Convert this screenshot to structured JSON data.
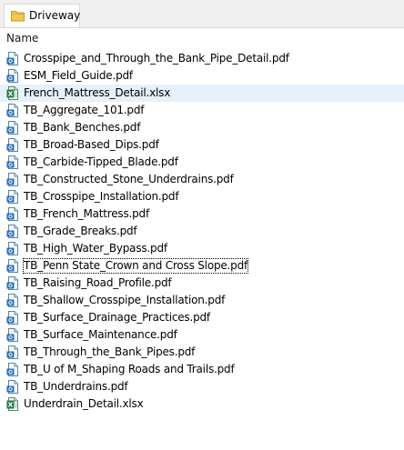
{
  "tab": {
    "label": "Driveway",
    "icon": "folder-icon"
  },
  "header": {
    "name_label": "Name"
  },
  "files": [
    {
      "name": "Crosspipe_and_Through_the_Bank_Pipe_Detail.pdf",
      "type": "pdf",
      "icon": "pdf-file-icon"
    },
    {
      "name": "ESM_Field_Guide.pdf",
      "type": "pdf",
      "icon": "pdf-file-icon"
    },
    {
      "name": "French_Mattress_Detail.xlsx",
      "type": "xlsx",
      "icon": "excel-file-icon",
      "selected": true
    },
    {
      "name": "TB_Aggregate_101.pdf",
      "type": "pdf",
      "icon": "pdf-file-icon"
    },
    {
      "name": "TB_Bank_Benches.pdf",
      "type": "pdf",
      "icon": "pdf-file-icon"
    },
    {
      "name": "TB_Broad-Based_Dips.pdf",
      "type": "pdf",
      "icon": "pdf-file-icon"
    },
    {
      "name": "TB_Carbide-Tipped_Blade.pdf",
      "type": "pdf",
      "icon": "pdf-file-icon"
    },
    {
      "name": "TB_Constructed_Stone_Underdrains.pdf",
      "type": "pdf",
      "icon": "pdf-file-icon"
    },
    {
      "name": "TB_Crosspipe_Installation.pdf",
      "type": "pdf",
      "icon": "pdf-file-icon"
    },
    {
      "name": "TB_French_Mattress.pdf",
      "type": "pdf",
      "icon": "pdf-file-icon"
    },
    {
      "name": "TB_Grade_Breaks.pdf",
      "type": "pdf",
      "icon": "pdf-file-icon"
    },
    {
      "name": "TB_High_Water_Bypass.pdf",
      "type": "pdf",
      "icon": "pdf-file-icon"
    },
    {
      "name": "TB_Penn State_Crown and Cross Slope.pdf",
      "type": "pdf",
      "icon": "pdf-file-icon",
      "focused": true
    },
    {
      "name": "TB_Raising_Road_Profile.pdf",
      "type": "pdf",
      "icon": "pdf-file-icon"
    },
    {
      "name": "TB_Shallow_Crosspipe_Installation.pdf",
      "type": "pdf",
      "icon": "pdf-file-icon"
    },
    {
      "name": "TB_Surface_Drainage_Practices.pdf",
      "type": "pdf",
      "icon": "pdf-file-icon"
    },
    {
      "name": "TB_Surface_Maintenance.pdf",
      "type": "pdf",
      "icon": "pdf-file-icon"
    },
    {
      "name": "TB_Through_the_Bank_Pipes.pdf",
      "type": "pdf",
      "icon": "pdf-file-icon"
    },
    {
      "name": "TB_U of M_Shaping Roads and Trails.pdf",
      "type": "pdf",
      "icon": "pdf-file-icon"
    },
    {
      "name": "TB_Underdrains.pdf",
      "type": "pdf",
      "icon": "pdf-file-icon"
    },
    {
      "name": "Underdrain_Detail.xlsx",
      "type": "xlsx",
      "icon": "excel-file-icon"
    }
  ],
  "colors": {
    "selection": "#e5f1fb",
    "pdf_icon": "#1f6fbf",
    "excel_icon": "#1d7a45",
    "folder_icon": "#f4c84a"
  }
}
